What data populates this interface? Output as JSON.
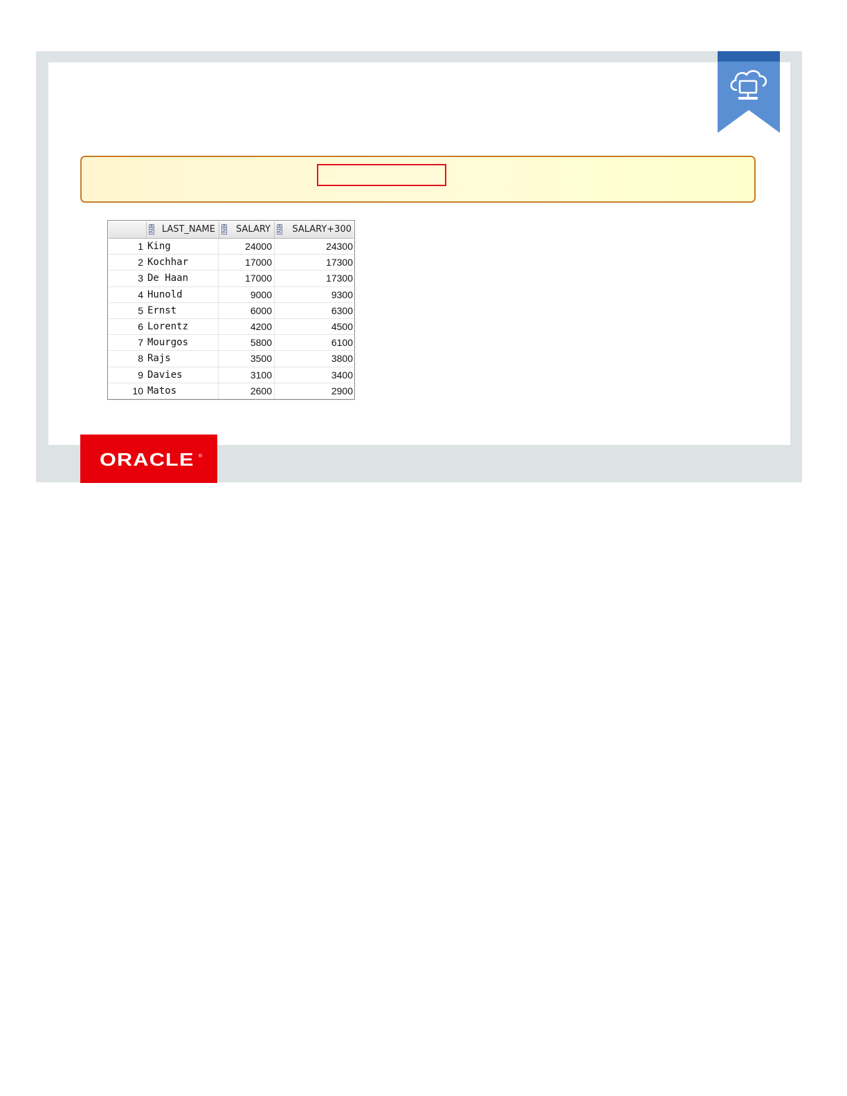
{
  "brand": {
    "logo_text": "ORACLE",
    "registered_mark": "®",
    "accent_color": "#e70009"
  },
  "ribbon": {
    "icon": "cloud-computer-icon",
    "color": "#5b8fd4",
    "top_color": "#2a62ae"
  },
  "code_box": {
    "highlight_color": "#e0141e",
    "border_color": "#c97d28"
  },
  "result_grid": {
    "columns": [
      "LAST_NAME",
      "SALARY",
      "SALARY+300"
    ],
    "rows": [
      {
        "num": "1",
        "last_name": "King",
        "salary": "24000",
        "salary_300": "24300"
      },
      {
        "num": "2",
        "last_name": "Kochhar",
        "salary": "17000",
        "salary_300": "17300"
      },
      {
        "num": "3",
        "last_name": "De Haan",
        "salary": "17000",
        "salary_300": "17300"
      },
      {
        "num": "4",
        "last_name": "Hunold",
        "salary": "9000",
        "salary_300": "9300"
      },
      {
        "num": "5",
        "last_name": "Ernst",
        "salary": "6000",
        "salary_300": "6300"
      },
      {
        "num": "6",
        "last_name": "Lorentz",
        "salary": "4200",
        "salary_300": "4500"
      },
      {
        "num": "7",
        "last_name": "Mourgos",
        "salary": "5800",
        "salary_300": "6100"
      },
      {
        "num": "8",
        "last_name": "Rajs",
        "salary": "3500",
        "salary_300": "3800"
      },
      {
        "num": "9",
        "last_name": "Davies",
        "salary": "3100",
        "salary_300": "3400"
      },
      {
        "num": "10",
        "last_name": "Matos",
        "salary": "2600",
        "salary_300": "2900"
      }
    ]
  }
}
